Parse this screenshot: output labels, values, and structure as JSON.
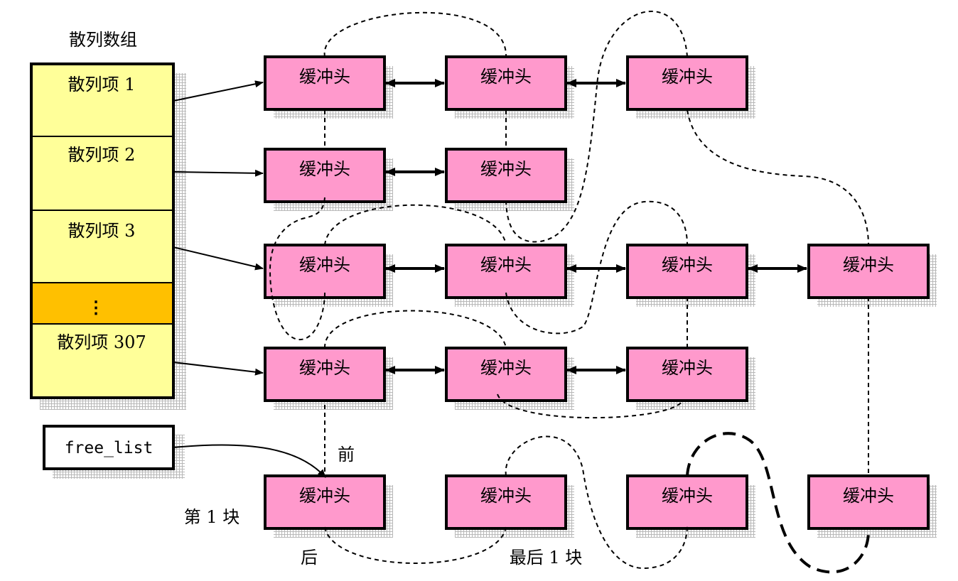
{
  "title": "散列数组",
  "hash_items": [
    "散列项 1",
    "散列项 2",
    "散列项 3",
    "散列项 307"
  ],
  "ellipsis": "⋮",
  "free_list_label": "free_list",
  "buffer_head_label": "缓冲头",
  "labels": {
    "front": "前",
    "back": "后",
    "first_block": "第 1 块",
    "last_block": "最后 1 块"
  }
}
